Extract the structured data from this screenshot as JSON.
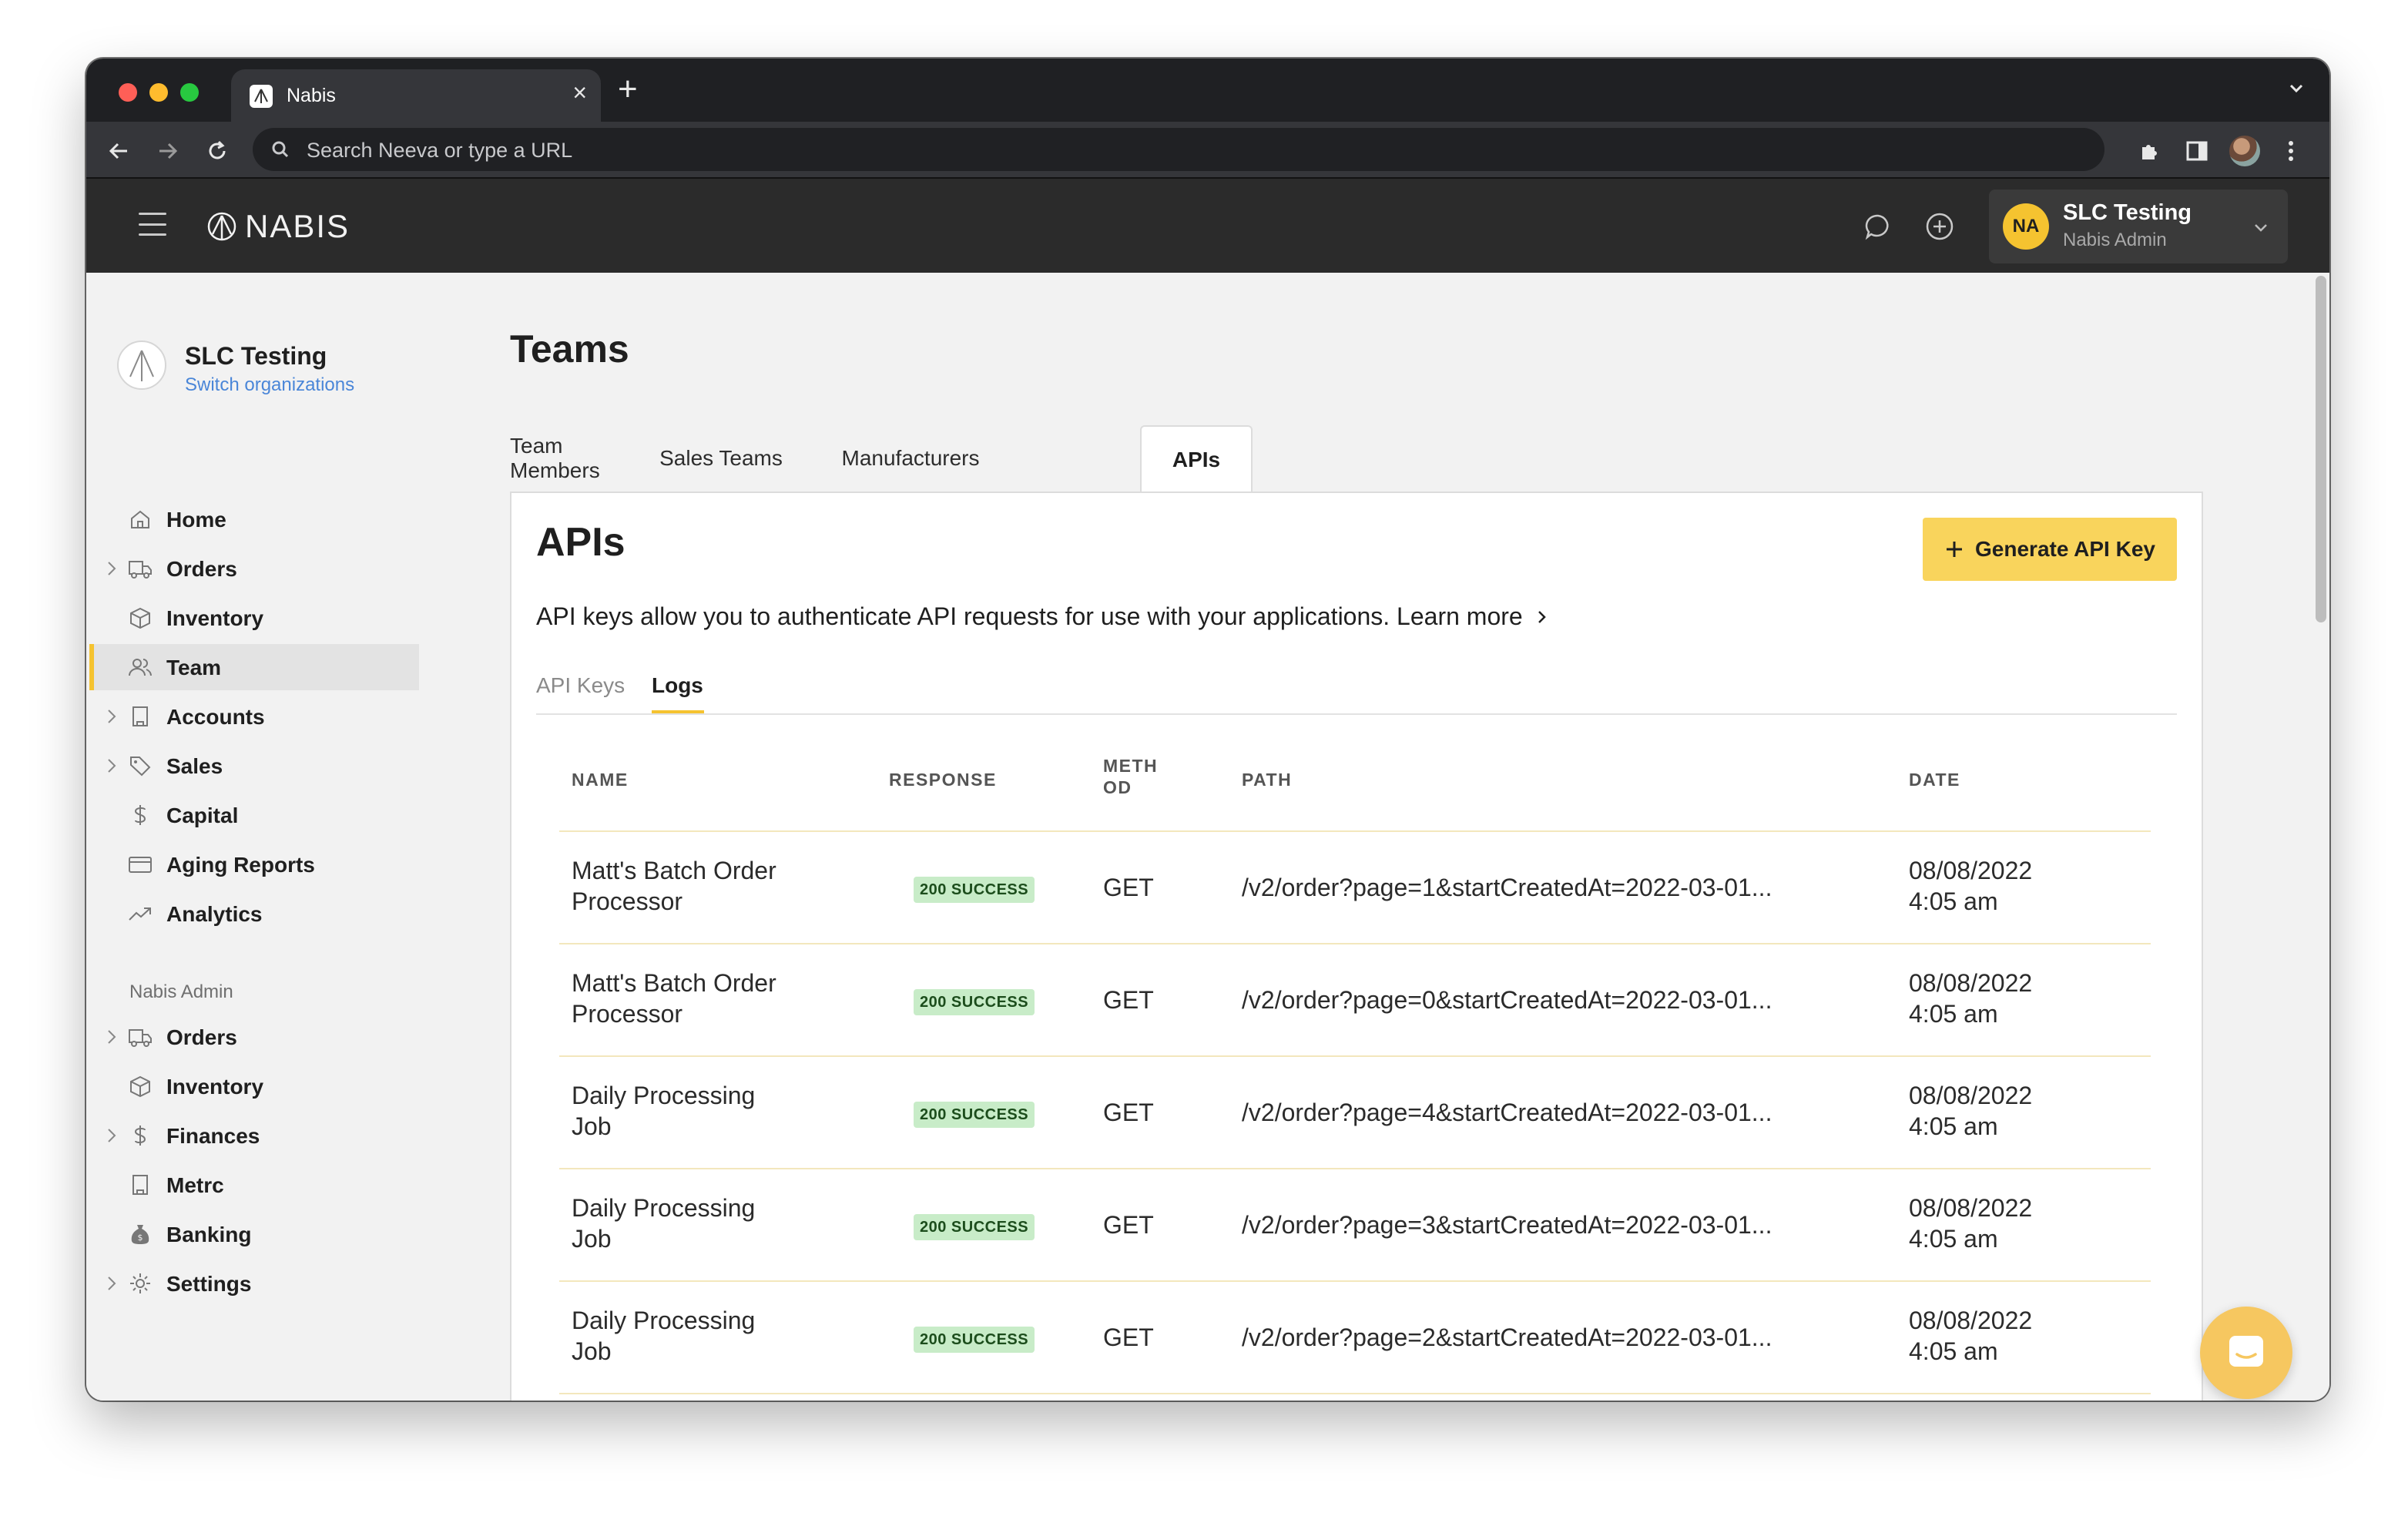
{
  "browser": {
    "tab_title": "Nabis",
    "address_placeholder": "Search Neeva or type a URL"
  },
  "header": {
    "logo_text": "NABIS",
    "org_name": "SLC Testing",
    "user_role": "Nabis Admin",
    "avatar_initials": "NA"
  },
  "sidebar": {
    "org_title": "SLC Testing",
    "switch_link": "Switch organizations",
    "items": [
      {
        "label": "Home",
        "icon": "home-icon"
      },
      {
        "label": "Orders",
        "icon": "truck-icon"
      },
      {
        "label": "Inventory",
        "icon": "box-icon"
      },
      {
        "label": "Team",
        "icon": "users-icon"
      },
      {
        "label": "Accounts",
        "icon": "building-icon"
      },
      {
        "label": "Sales",
        "icon": "tag-icon"
      },
      {
        "label": "Capital",
        "icon": "dollar-icon"
      },
      {
        "label": "Aging Reports",
        "icon": "card-icon"
      },
      {
        "label": "Analytics",
        "icon": "trend-icon"
      }
    ],
    "admin_section_label": "Nabis Admin",
    "admin_items": [
      {
        "label": "Orders",
        "icon": "truck-icon"
      },
      {
        "label": "Inventory",
        "icon": "box-icon"
      },
      {
        "label": "Finances",
        "icon": "dollar-icon"
      },
      {
        "label": "Metrc",
        "icon": "building-icon"
      },
      {
        "label": "Banking",
        "icon": "money-bag-icon"
      },
      {
        "label": "Settings",
        "icon": "gear-icon"
      }
    ]
  },
  "main": {
    "page_title": "Teams",
    "tabs": [
      {
        "label": "Team Members"
      },
      {
        "label": "Sales Teams"
      },
      {
        "label": "Manufacturers"
      },
      {
        "label": "APIs"
      }
    ],
    "panel_title": "APIs",
    "generate_button": "Generate API Key",
    "description": "API keys allow you to authenticate API requests for use with your applications. Learn more",
    "subtabs": [
      {
        "label": "API Keys"
      },
      {
        "label": "Logs"
      }
    ],
    "table": {
      "headers": {
        "name": "NAME",
        "response": "RESPONSE",
        "method_1": "METH",
        "method_2": "OD",
        "path": "PATH",
        "date": "DATE"
      },
      "rows": [
        {
          "name_1": "Matt's Batch Order",
          "name_2": "Processor",
          "response": "200 SUCCESS",
          "method": "GET",
          "path": "/v2/order?page=1&startCreatedAt=2022-03-01...",
          "date": "08/08/2022",
          "time": "4:05 am"
        },
        {
          "name_1": "Matt's Batch Order",
          "name_2": "Processor",
          "response": "200 SUCCESS",
          "method": "GET",
          "path": "/v2/order?page=0&startCreatedAt=2022-03-01...",
          "date": "08/08/2022",
          "time": "4:05 am"
        },
        {
          "name_1": "Daily Processing",
          "name_2": "Job",
          "response": "200 SUCCESS",
          "method": "GET",
          "path": "/v2/order?page=4&startCreatedAt=2022-03-01...",
          "date": "08/08/2022",
          "time": "4:05 am"
        },
        {
          "name_1": "Daily Processing",
          "name_2": "Job",
          "response": "200 SUCCESS",
          "method": "GET",
          "path": "/v2/order?page=3&startCreatedAt=2022-03-01...",
          "date": "08/08/2022",
          "time": "4:05 am"
        },
        {
          "name_1": "Daily Processing",
          "name_2": "Job",
          "response": "200 SUCCESS",
          "method": "GET",
          "path": "/v2/order?page=2&startCreatedAt=2022-03-01...",
          "date": "08/08/2022",
          "time": "4:05 am"
        }
      ]
    }
  },
  "colors": {
    "accent": "#f5c330",
    "button": "#f9d45c",
    "success_bg": "#c8ecc8",
    "link": "#4a86d8",
    "header_bg": "#2b2b2b"
  }
}
